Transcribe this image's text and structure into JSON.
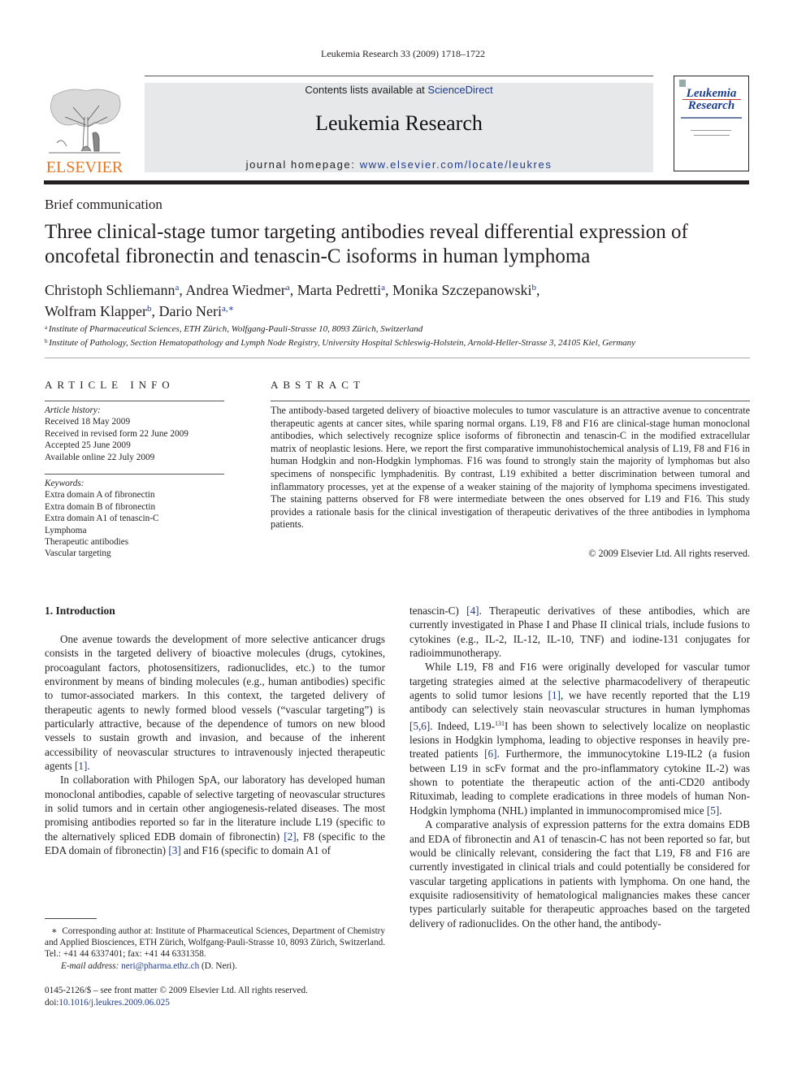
{
  "header": {
    "citation": "Leukemia Research 33 (2009) 1718–1722",
    "contents_prefix": "Contents lists available at ",
    "sciencedirect_link": "ScienceDirect",
    "journal_name": "Leukemia Research",
    "homepage_prefix": "journal homepage: ",
    "homepage_url": "www.elsevier.com/locate/leukres",
    "publisher_logo_text": "ELSEVIER",
    "cover_title_line1": "Leukemia",
    "cover_title_line2": "Research"
  },
  "article": {
    "type": "Brief communication",
    "title": "Three clinical-stage tumor targeting antibodies reveal differential expression of oncofetal fibronectin and tenascin-C isoforms in human lymphoma",
    "authors": [
      {
        "name": "Christoph Schliemann",
        "aff": "a",
        "sep": ", "
      },
      {
        "name": "Andrea Wiedmer",
        "aff": "a",
        "sep": ", "
      },
      {
        "name": "Marta Pedretti",
        "aff": "a",
        "sep": ", "
      },
      {
        "name": "Monika Szczepanowski",
        "aff": "b",
        "sep": ","
      },
      {
        "name": "Wolfram Klapper",
        "aff": "b",
        "sep": ", "
      },
      {
        "name": "Dario Neri",
        "aff": "a,∗",
        "sep": ""
      }
    ],
    "affiliations": [
      {
        "key": "a",
        "text": "Institute of Pharmaceutical Sciences, ETH Zürich, Wolfgang-Pauli-Strasse 10, 8093 Zürich, Switzerland"
      },
      {
        "key": "b",
        "text": "Institute of Pathology, Section Hematopathology and Lymph Node Registry, University Hospital Schleswig-Holstein, Arnold-Heller-Strasse 3, 24105 Kiel, Germany"
      }
    ]
  },
  "article_info": {
    "heading": "ARTICLE INFO",
    "history_label": "Article history:",
    "history": [
      "Received 18 May 2009",
      "Received in revised form 22 June 2009",
      "Accepted 25 June 2009",
      "Available online 22 July 2009"
    ],
    "keywords_label": "Keywords:",
    "keywords": [
      "Extra domain A of fibronectin",
      "Extra domain B of fibronectin",
      "Extra domain A1 of tenascin-C",
      "Lymphoma",
      "Therapeutic antibodies",
      "Vascular targeting"
    ]
  },
  "abstract": {
    "heading": "ABSTRACT",
    "text": "The antibody-based targeted delivery of bioactive molecules to tumor vasculature is an attractive avenue to concentrate therapeutic agents at cancer sites, while sparing normal organs. L19, F8 and F16 are clinical-stage human monoclonal antibodies, which selectively recognize splice isoforms of fibronectin and tenascin-C in the modified extracellular matrix of neoplastic lesions. Here, we report the first comparative immunohistochemical analysis of L19, F8 and F16 in human Hodgkin and non-Hodgkin lymphomas. F16 was found to strongly stain the majority of lymphomas but also specimens of nonspecific lymphadenitis. By contrast, L19 exhibited a better discrimination between tumoral and inflammatory processes, yet at the expense of a weaker staining of the majority of lymphoma specimens investigated. The staining patterns observed for F8 were intermediate between the ones observed for L19 and F16. This study provides a rationale basis for the clinical investigation of therapeutic derivatives of the three antibodies in lymphoma patients.",
    "copyright": "© 2009 Elsevier Ltd. All rights reserved."
  },
  "body": {
    "section_heading": "1.  Introduction",
    "left_paragraphs": [
      [
        {
          "t": "One avenue towards the development of more selective anticancer drugs consists in the targeted delivery of bioactive molecules (drugs, cytokines, procoagulant factors, photosensitizers, radionuclides, etc.) to the tumor environment by means of binding molecules (e.g., human antibodies) specific to tumor-associated markers. In this context, the targeted delivery of therapeutic agents to newly formed blood vessels (“vascular targeting”) is particularly attractive, because of the dependence of tumors on new blood vessels to sustain growth and invasion, and because of the inherent accessibility of neovascular structures to intravenously injected therapeutic agents "
        },
        {
          "ref": "[1]"
        },
        {
          "t": "."
        }
      ],
      [
        {
          "t": "In collaboration with Philogen SpA, our laboratory has developed human monoclonal antibodies, capable of selective targeting of neovascular structures in solid tumors and in certain other angiogenesis-related diseases. The most promising antibodies reported so far in the literature include L19 (specific to the alternatively spliced EDB domain of fibronectin) "
        },
        {
          "ref": "[2]"
        },
        {
          "t": ", F8 (specific to the EDA domain of fibronectin) "
        },
        {
          "ref": "[3]"
        },
        {
          "t": " and F16 (specific to domain A1 of"
        }
      ]
    ],
    "right_paragraphs": [
      [
        {
          "t": "tenascin-C) "
        },
        {
          "ref": "[4]"
        },
        {
          "t": ". Therapeutic derivatives of these antibodies, which are currently investigated in Phase I and Phase II clinical trials, include fusions to cytokines (e.g., IL-2, IL-12, IL-10, TNF) and iodine-131 conjugates for radioimmunotherapy."
        }
      ],
      [
        {
          "t": "While L19, F8 and F16 were originally developed for vascular tumor targeting strategies aimed at the selective pharmacodelivery of therapeutic agents to solid tumor lesions "
        },
        {
          "ref": "[1]"
        },
        {
          "t": ", we have recently reported that the L19 antibody can selectively stain neovascular structures in human lymphomas "
        },
        {
          "ref": "[5,6]"
        },
        {
          "t": ". Indeed, L19-"
        },
        {
          "sup": "131"
        },
        {
          "t": "I has been shown to selectively localize on neoplastic lesions in Hodgkin lymphoma, leading to objective responses in heavily pre-treated patients "
        },
        {
          "ref": "[6]"
        },
        {
          "t": ". Furthermore, the immunocytokine L19-IL2 (a fusion between L19 in scFv format and the pro-inflammatory cytokine IL-2) was shown to potentiate the therapeutic action of the anti-CD20 antibody Rituximab, leading to complete eradications in three models of human Non-Hodgkin lymphoma (NHL) implanted in immunocompromised mice "
        },
        {
          "ref": "[5]"
        },
        {
          "t": "."
        }
      ],
      [
        {
          "t": "A comparative analysis of expression patterns for the extra domains EDB and EDA of fibronectin and A1 of tenascin-C has not been reported so far, but would be clinically relevant, considering the fact that L19, F8 and F16 are currently investigated in clinical trials and could potentially be considered for vascular targeting applications in patients with lymphoma. On one hand, the exquisite radiosensitivity of hematological malignancies makes these cancer types particularly suitable for therapeutic approaches based on the targeted delivery of radionuclides. On the other hand, the antibody-"
        }
      ]
    ]
  },
  "footnote": {
    "marker": "∗",
    "corresponding": "Corresponding author at: Institute of Pharmaceutical Sciences, Department of Chemistry and Applied Biosciences, ETH Zürich, Wolfgang-Pauli-Strasse 10, 8093 Zürich, Switzerland. Tel.: +41 44 6337401; fax: +41 44 6331358.",
    "email_label": "E-mail address:",
    "email": "neri@pharma.ethz.ch",
    "email_suffix": " (D. Neri)."
  },
  "front_matter": {
    "issn_line": "0145-2126/$ – see front matter © 2009 Elsevier Ltd. All rights reserved.",
    "doi_prefix": "doi:",
    "doi": "10.1016/j.leukres.2009.06.025"
  },
  "colors": {
    "link_blue": "#1f3b8a",
    "elsevier_orange": "#e87722",
    "banner_gray": "#e7e8ea"
  }
}
